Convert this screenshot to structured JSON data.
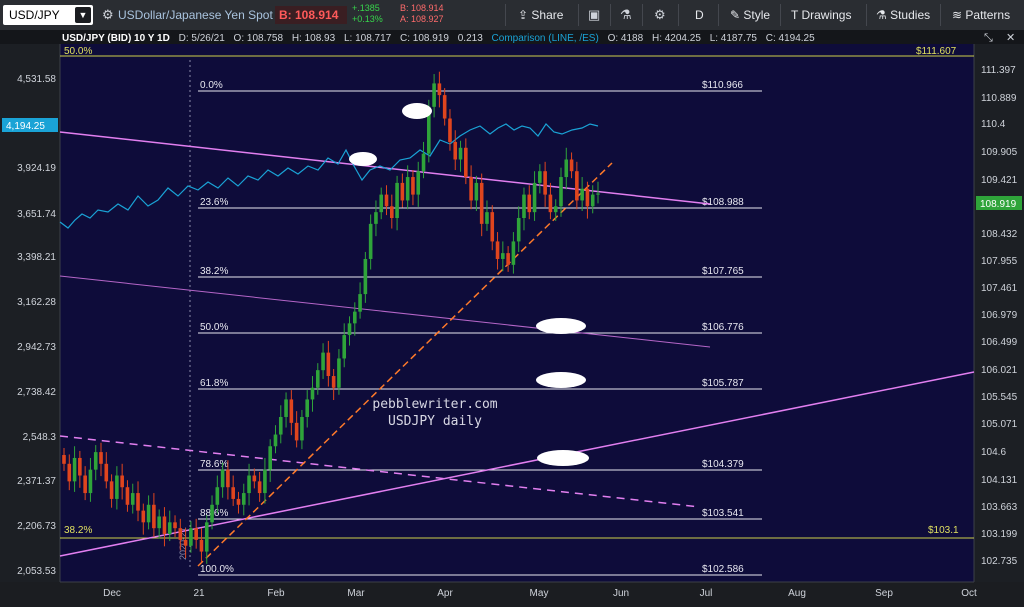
{
  "toolbar": {
    "symbol": "USD/JPY",
    "instrument_name": "USDollar/Japanese Yen Spot",
    "last_label": "B: 108.914",
    "change": "+.1385",
    "change_pct": "+0.13%",
    "bid": "B: 108.914",
    "ask": "A: 108.927",
    "share_label": "Share",
    "period_label": "D",
    "style_label": "Style",
    "drawings_label": "Drawings",
    "studies_label": "Studies",
    "patterns_label": "Patterns"
  },
  "header": {
    "main_series": "USD/JPY (BID) 10 Y 1D",
    "date": "D: 5/26/21",
    "open": "O: 108.758",
    "high": "H: 108.93",
    "low": "L: 108.717",
    "close": "C: 108.919",
    "change": "0.213",
    "comparison": "Comparison (LINE, /ES)",
    "cmp_open": "O: 4188",
    "cmp_high": "H: 4204.25",
    "cmp_low": "L: 4187.75",
    "cmp_close": "C: 4194.25",
    "collapse_icon": "collapse-icon",
    "close_icon": "close-icon"
  },
  "colors": {
    "background": "#0e0c3a",
    "up_candle": "#2fa43a",
    "down_candle": "#e0451e",
    "comparison_line": "#1aa3d6",
    "trend_magenta": "#e27ff0",
    "fib_line": "#e8e8f0",
    "fib_outer": "#cfd04a",
    "trendline_orange": "#ff7a2a"
  },
  "chart_data": {
    "type": "candlestick",
    "title": "USD/JPY (BID) 10 Y 1D",
    "x_tick_labels": [
      "Dec",
      "21",
      "Feb",
      "Mar",
      "Apr",
      "May",
      "Jun",
      "Jul",
      "Aug",
      "Sep",
      "Oct"
    ],
    "right_axis": {
      "label": "USD/JPY",
      "ticks": [
        "111.397",
        "110.889",
        "110.4",
        "109.905",
        "109.421",
        "108.432",
        "107.955",
        "107.461",
        "106.979",
        "106.499",
        "106.021",
        "105.545",
        "105.071",
        "104.6",
        "104.131",
        "103.663",
        "103.199",
        "102.735"
      ],
      "current_value_label": "108.919",
      "ylim": [
        102.5,
        111.9
      ]
    },
    "left_axis": {
      "label": "/ES",
      "ticks": [
        "4,531.58",
        "3,924.19",
        "3,651.74",
        "3,398.21",
        "3,162.28",
        "2,942.73",
        "2,738.42",
        "2,548.3",
        "2,371.37",
        "2,206.73",
        "2,053.53"
      ],
      "current_value_label": "4,194.25",
      "scale": "log"
    },
    "fibonacci": [
      {
        "label": "0.0%",
        "price_label": "$110.966"
      },
      {
        "label": "23.6%",
        "price_label": "$108.988"
      },
      {
        "label": "38.2%",
        "price_label": "$107.765"
      },
      {
        "label": "50.0%",
        "price_label": "$106.776"
      },
      {
        "label": "61.8%",
        "price_label": "$105.787"
      },
      {
        "label": "78.6%",
        "price_label": "$104.379"
      },
      {
        "label": "88.6%",
        "price_label": "$103.541"
      },
      {
        "label": "100.0%",
        "price_label": "$102.586"
      }
    ],
    "outer_fibonacci": [
      {
        "label": "50.0%",
        "price_label": "$111.607"
      },
      {
        "label": "38.2%",
        "price_label": "$103.1"
      }
    ],
    "annotation_text": [
      "pebblewriter.com",
      "USDJPY daily"
    ],
    "candles_close": [
      104.3,
      104.0,
      104.4,
      104.1,
      103.8,
      104.2,
      104.5,
      104.3,
      104.0,
      103.7,
      104.1,
      103.9,
      103.6,
      103.8,
      103.5,
      103.3,
      103.6,
      103.2,
      103.4,
      103.1,
      103.3,
      103.2,
      103.0,
      102.9,
      103.2,
      103.0,
      102.8,
      103.3,
      103.6,
      103.9,
      104.2,
      103.9,
      103.7,
      103.6,
      103.8,
      104.1,
      104.0,
      103.8,
      104.2,
      104.6,
      104.8,
      105.1,
      105.4,
      105.0,
      104.7,
      105.1,
      105.4,
      105.6,
      105.9,
      106.2,
      105.8,
      105.6,
      106.1,
      106.5,
      106.7,
      106.9,
      107.2,
      107.8,
      108.4,
      108.6,
      108.9,
      108.7,
      108.5,
      109.1,
      108.8,
      109.2,
      108.9,
      109.3,
      109.6,
      110.4,
      110.8,
      110.6,
      110.2,
      109.8,
      109.5,
      109.7,
      109.2,
      108.8,
      109.1,
      108.4,
      108.6,
      108.1,
      107.8,
      107.9,
      107.7,
      108.1,
      108.5,
      108.9,
      108.6,
      109.1,
      109.3,
      108.9,
      108.6,
      108.7,
      109.2,
      109.5,
      109.3,
      108.8,
      109.0,
      108.7,
      108.9,
      108.919
    ]
  }
}
